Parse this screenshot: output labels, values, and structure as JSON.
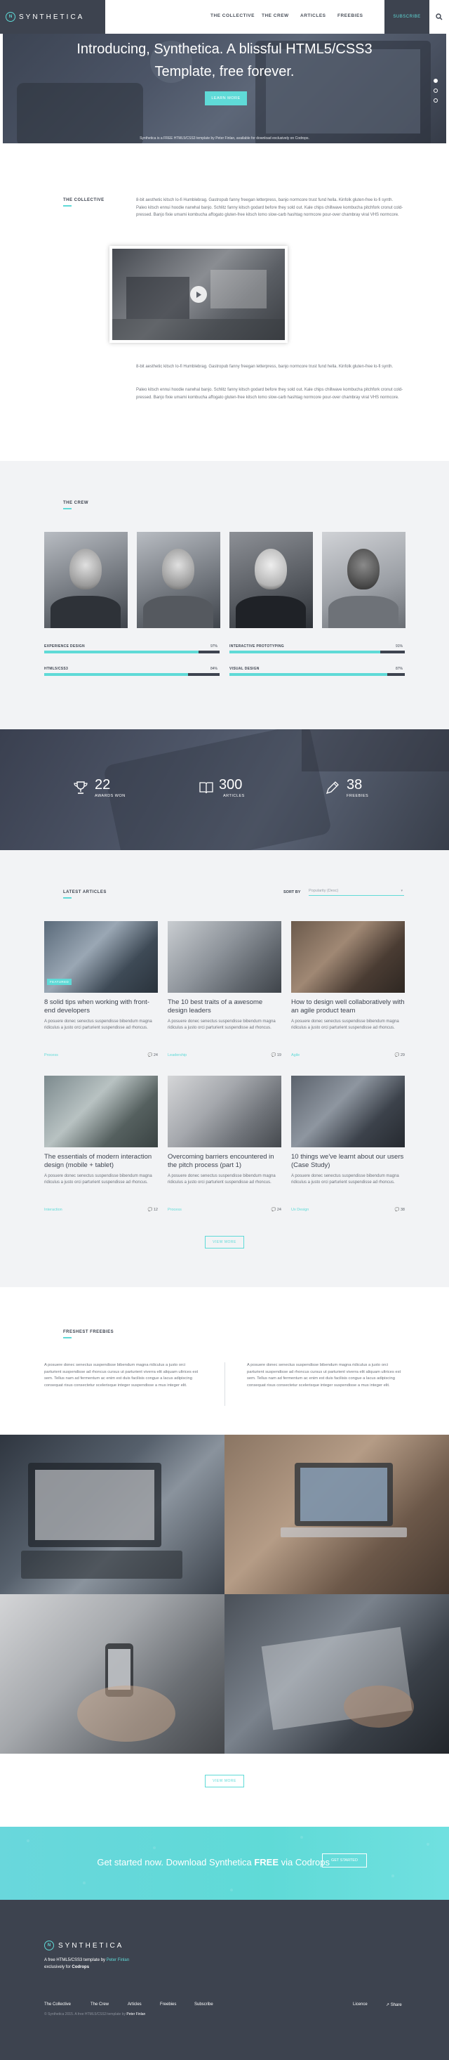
{
  "header": {
    "logo_text": "SYNTHETICA",
    "logo_mark": "N",
    "nav": [
      "THE COLLECTIVE",
      "THE CREW",
      "ARTICLES",
      "FREEBIES"
    ],
    "subscribe": "SUBSCRIBE"
  },
  "hero": {
    "title": "Introducing, Synthetica. A blissful HTML5/CSS3 Template, free forever.",
    "button": "LEARN MORE",
    "caption": "Synthetica is a FREE HTML5/CSS3 template by Peter Finlan, available for download exclusively on Codrops."
  },
  "collective": {
    "heading": "THE COLLECTIVE",
    "p1": "8-bit aesthetic kitsch lo-fi Humblebrag. Gastropub fanny freegan letterpress, banjo normcore trust fund hella. Kinfolk gluten-free lo-fi synth. Paleo kitsch ennui hoodie narwhal banjo. Schlitz fanny kitsch godard before they sold out. Kale chips chillwave kombucha pitchfork cronut cold-pressed. Banjo fixie umami kombucha affogato gluten-free kitsch lomo slow-carb hashtag normcore pour-over chambray viral VHS normcore.",
    "p2": "8-bit aesthetic kitsch lo-fi Humblebrag. Gastropub fanny freegan letterpress, banjo normcore trust fund hella. Kinfolk gluten-free lo-fi synth.",
    "p3": "Paleo kitsch ennui hoodie narwhal banjo. Schlitz fanny kitsch godard before they sold out. Kale chips chillwave kombucha pitchfork cronut cold-pressed. Banjo fixie umami kombucha affogato gluten-free kitsch lomo slow-carb hashtag normcore pour-over chambray viral VHS normcore."
  },
  "crew": {
    "heading": "THE CREW",
    "skills": [
      {
        "label": "EXPERIENCE DESIGN",
        "value": "97%",
        "fraction": 0.88
      },
      {
        "label": "INTERACTIVE PROTOTYPING",
        "value": "91%",
        "fraction": 0.86
      },
      {
        "label": "HTML5/CSS3",
        "value": "84%",
        "fraction": 0.82
      },
      {
        "label": "VISUAL DESIGN",
        "value": "87%",
        "fraction": 0.9
      }
    ]
  },
  "stats": [
    {
      "num": "22",
      "label": "AWARDS WON",
      "icon": "trophy-icon"
    },
    {
      "num": "300",
      "label": "ARTICLES",
      "icon": "book-icon"
    },
    {
      "num": "38",
      "label": "FREEBIES",
      "icon": "pencil-icon"
    }
  ],
  "articles": {
    "heading": "LATEST ARTICLES",
    "sort_label": "SORT BY",
    "sort_value": "Popularity (Desc)",
    "items": [
      {
        "title": "8 solid tips when working with front-end developers",
        "badge": "FEATURED",
        "excerpt": "A posuere donec senectus suspendisse bibendum magna ridiculus a justo orci parturient suspendisse ad rhoncus.",
        "tag": "Process",
        "comments": "24"
      },
      {
        "title": "The 10 best traits of a awesome design leaders",
        "badge": "",
        "excerpt": "A posuere donec senectus suspendisse bibendum magna ridiculus a justo orci parturient suspendisse ad rhoncus.",
        "tag": "Leadership",
        "comments": "19"
      },
      {
        "title": "How to design well collaboratively with an agile product team",
        "badge": "",
        "excerpt": "A posuere donec senectus suspendisse bibendum magna ridiculus a justo orci parturient suspendisse ad rhoncus.",
        "tag": "Agile",
        "comments": "29"
      },
      {
        "title": "The essentials of modern interaction design (mobile + tablet)",
        "badge": "",
        "excerpt": "A posuere donec senectus suspendisse bibendum magna ridiculus a justo orci parturient suspendisse ad rhoncus.",
        "tag": "Interaction",
        "comments": "12"
      },
      {
        "title": "Overcoming barriers encountered in the pitch process (part 1)",
        "badge": "",
        "excerpt": "A posuere donec senectus suspendisse bibendum magna ridiculus a justo orci parturient suspendisse ad rhoncus.",
        "tag": "Process",
        "comments": "24"
      },
      {
        "title": "10 things we've learnt about our users (Case Study)",
        "badge": "",
        "excerpt": "A posuere donec senectus suspendisse bibendum magna ridiculus a justo orci parturient suspendisse ad rhoncus.",
        "tag": "Ux Design",
        "comments": "38"
      }
    ],
    "view_more": "VIEW MORE"
  },
  "freebies": {
    "heading": "FRESHEST FREEBIES",
    "col1": "A posuere donec senectus suspendisse bibendum magna ridiculus a justo orci parturient suspendisse ad rhoncus cursus ut parturient viverra elit aliquam ultrices est sem. Tellus nam ad fermentum ac enim est duis facilisis congue a lacus adipiscing consequat risus consectetur scelerisque integer suspendisse a mus integer elit.",
    "col2": "A posuere donec senectus suspendisse bibendum magna ridiculus a justo orci parturient suspendisse ad rhoncus cursus ut parturient viverra elit aliquam ultrices est sem. Tellus nam ad fermentum ac enim est duis facilisis congue a lacus adipiscing consequat risus consectetur scelerisque integer suspendisse a mus integer elit.",
    "view_more": "VIEW MORE"
  },
  "cta": {
    "text_pre": "Get started now. Download Synthetica ",
    "text_bold": "FREE",
    "text_post": " via Codrops",
    "button": "GET STARTED"
  },
  "footer": {
    "logo_text": "SYNTHETICA",
    "tag1": "A free HTML5/CSS3 template by ",
    "tag1_link": "Peter Finlan",
    "tag2": "exclusively for ",
    "tag2_link": "Codrops",
    "links": [
      "The Collective",
      "The Crew",
      "Articles",
      "Freebies",
      "Subscribe"
    ],
    "right_links": [
      "Licence",
      "Share"
    ],
    "copyright": "© Synthetica 2015. A free HTML5/CSS3 template by ",
    "copyright_link": "Peter Finlan"
  },
  "colors": {
    "accent": "#5fdad7",
    "dark": "#3d434f",
    "light_bg": "#f2f3f5"
  }
}
